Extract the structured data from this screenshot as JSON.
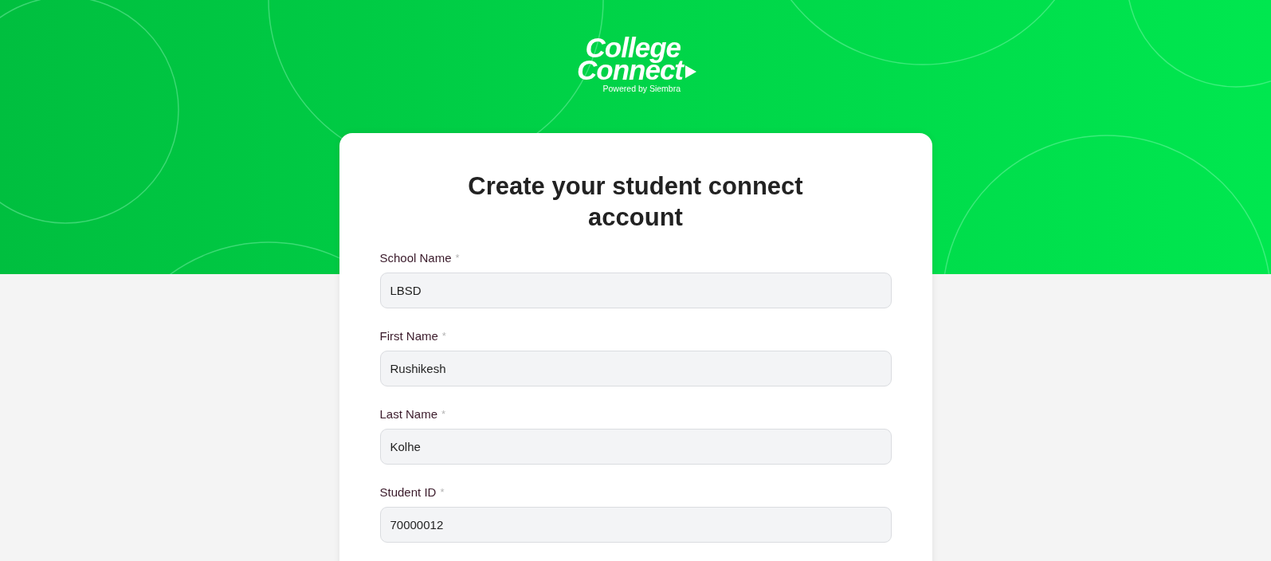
{
  "logo": {
    "line_1": "College",
    "line_2": "Connect",
    "tagline": "Powered by Siembra"
  },
  "form": {
    "title": "Create your student connect account",
    "fields": [
      {
        "label": "School Name",
        "required_mark": "*",
        "value": "LBSD"
      },
      {
        "label": "First Name",
        "required_mark": "*",
        "value": "Rushikesh"
      },
      {
        "label": "Last Name",
        "required_mark": "*",
        "value": "Kolhe"
      },
      {
        "label": "Student ID",
        "required_mark": "*",
        "value": "70000012"
      }
    ]
  }
}
